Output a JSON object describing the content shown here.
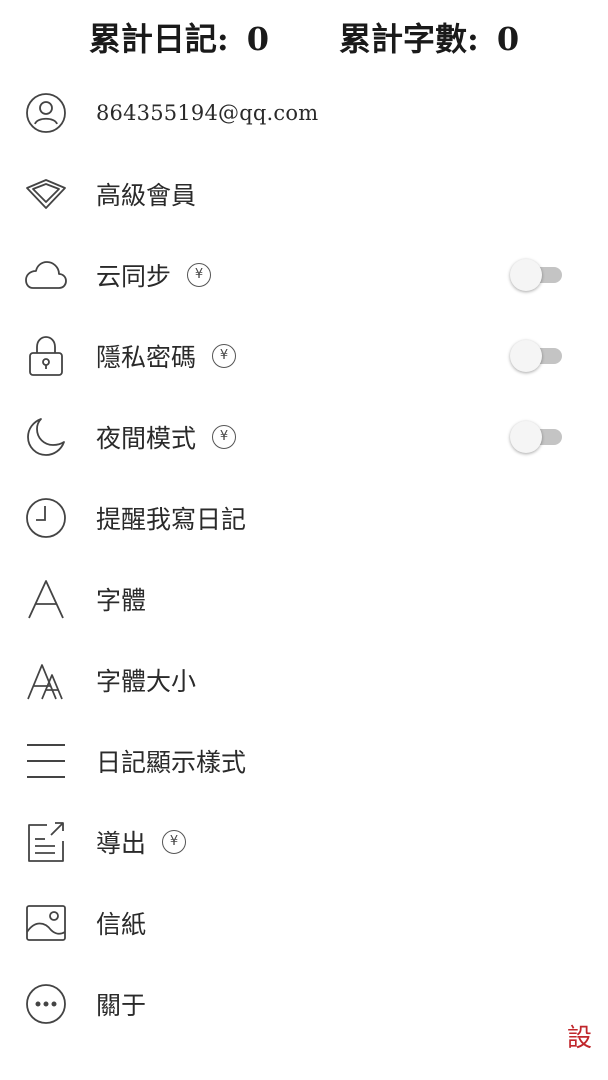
{
  "stats": {
    "diary_label": "累計日記:",
    "diary_count": "0",
    "words_label": "累計字數:",
    "words_count": "0"
  },
  "menu": {
    "account": {
      "label": "864355194@qq.com",
      "icon": "user-icon"
    },
    "premium": {
      "label": "高級會員",
      "icon": "diamond-icon"
    },
    "cloud_sync": {
      "label": "云同步",
      "icon": "cloud-icon",
      "badge": "¥",
      "enabled": false
    },
    "privacy_password": {
      "label": "隱私密碼",
      "icon": "lock-icon",
      "badge": "¥",
      "enabled": false
    },
    "night_mode": {
      "label": "夜間模式",
      "icon": "moon-icon",
      "badge": "¥",
      "enabled": false
    },
    "reminder": {
      "label": "提醒我寫日記",
      "icon": "clock-icon"
    },
    "font": {
      "label": "字體",
      "icon": "font-icon"
    },
    "font_size": {
      "label": "字體大小",
      "icon": "font-size-icon"
    },
    "display_style": {
      "label": "日記顯示樣式",
      "icon": "menu-lines-icon"
    },
    "export": {
      "label": "導出",
      "icon": "export-icon",
      "badge": "¥"
    },
    "stationery": {
      "label": "信紙",
      "icon": "image-icon"
    },
    "about": {
      "label": "關于",
      "icon": "more-icon"
    }
  },
  "settings_tab": {
    "label": "設"
  },
  "colors": {
    "text": "#2a2a2a",
    "toggle_track": "#c4c4c4",
    "toggle_knob": "#f5f5f5",
    "accent_red": "#c0262b"
  }
}
